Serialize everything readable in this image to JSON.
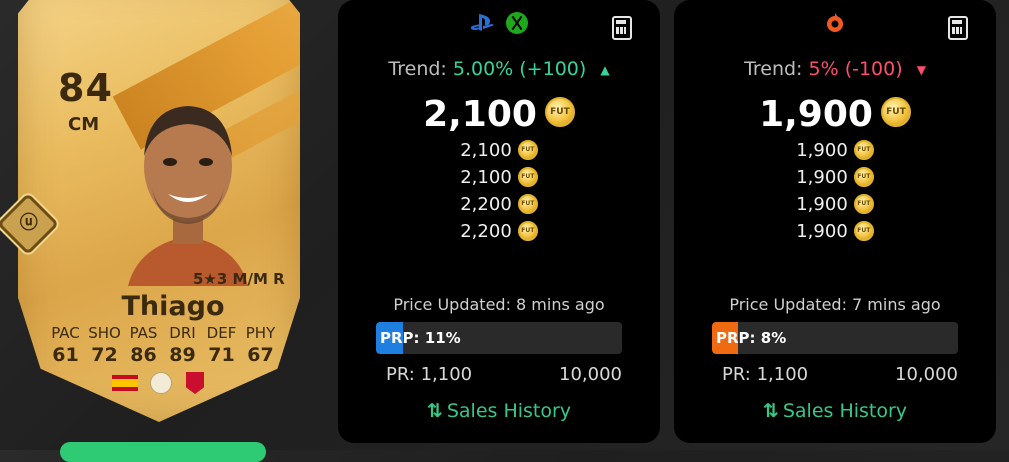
{
  "player": {
    "rating": "84",
    "position": "CM",
    "name": "Thiago",
    "skill_line": "5★3 M/M R",
    "stats": [
      {
        "label": "PAC",
        "value": "61"
      },
      {
        "label": "SHO",
        "value": "72"
      },
      {
        "label": "PAS",
        "value": "86"
      },
      {
        "label": "DRI",
        "value": "89"
      },
      {
        "label": "DEF",
        "value": "71"
      },
      {
        "label": "PHY",
        "value": "67"
      }
    ],
    "nation_icon": "spain-flag-icon",
    "league_icon": "premier-league-icon",
    "club_icon": "liverpool-crest-icon",
    "colors": {
      "card_gold": "#e9bb5e",
      "text_dark": "#3b2a10"
    }
  },
  "console_panel": {
    "platform_icons": [
      "playstation-icon",
      "xbox-icon"
    ],
    "trend_label": "Trend:",
    "trend_value": "5.00% (+100)",
    "trend_arrow": "▲",
    "trend_direction": "up",
    "main_price": "2,100",
    "coin_label": "FUT",
    "prices": [
      "2,100",
      "2,100",
      "2,200",
      "2,200"
    ],
    "updated": "Price Updated: 8 mins ago",
    "prp_label": "PRP",
    "prp_value": ": 11%",
    "prp_fraction": 0.11,
    "prp_color": "#1f7fe0",
    "pr_label": "PR: 1,100",
    "pr_max": "10,000",
    "sales_history_icon": "⇅",
    "sales_history_label": "Sales History"
  },
  "pc_panel": {
    "platform_icons": [
      "origin-icon"
    ],
    "trend_label": "Trend:",
    "trend_value": "5% (-100)",
    "trend_arrow": "▼",
    "trend_direction": "down",
    "main_price": "1,900",
    "coin_label": "FUT",
    "prices": [
      "1,900",
      "1,900",
      "1,900",
      "1,900"
    ],
    "updated": "Price Updated: 7 mins ago",
    "prp_label": "PRP",
    "prp_value": ": 8%",
    "prp_fraction": 0.08,
    "prp_color": "#ef6a10",
    "pr_label": "PR: 1,100",
    "pr_max": "10,000",
    "sales_history_icon": "⇅",
    "sales_history_label": "Sales History"
  },
  "colors": {
    "up": "#35d49a",
    "down": "#ff4d6d",
    "sales_link": "#35c989"
  }
}
